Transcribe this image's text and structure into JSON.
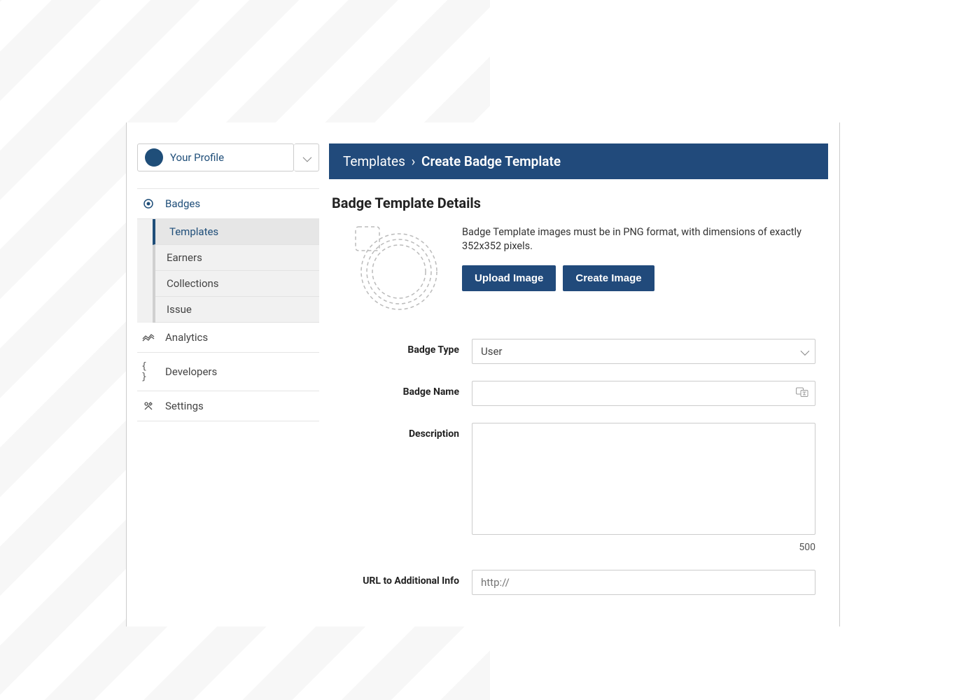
{
  "profile": {
    "label": "Your Profile"
  },
  "sidebar": {
    "items": [
      {
        "label": "Badges",
        "icon": "badge-target-icon",
        "active": true,
        "children": [
          {
            "label": "Templates",
            "active": true
          },
          {
            "label": "Earners"
          },
          {
            "label": "Collections"
          },
          {
            "label": "Issue"
          }
        ]
      },
      {
        "label": "Analytics",
        "icon": "analytics-icon"
      },
      {
        "label": "Developers",
        "icon": "code-braces-icon"
      },
      {
        "label": "Settings",
        "icon": "tools-icon"
      }
    ]
  },
  "header": {
    "crumb_parent": "Templates",
    "crumb_sep": "›",
    "crumb_current": "Create Badge Template"
  },
  "details": {
    "section_title": "Badge Template Details",
    "image_hint": "Badge Template images must be in PNG format, with dimensions of exactly 352x352 pixels.",
    "upload_label": "Upload Image",
    "create_label": "Create Image",
    "fields": {
      "badge_type": {
        "label": "Badge Type",
        "value": "User"
      },
      "badge_name": {
        "label": "Badge Name",
        "value": ""
      },
      "description": {
        "label": "Description",
        "value": "",
        "char_limit": "500"
      },
      "url": {
        "label": "URL to Additional Info",
        "placeholder": "http://"
      }
    }
  }
}
